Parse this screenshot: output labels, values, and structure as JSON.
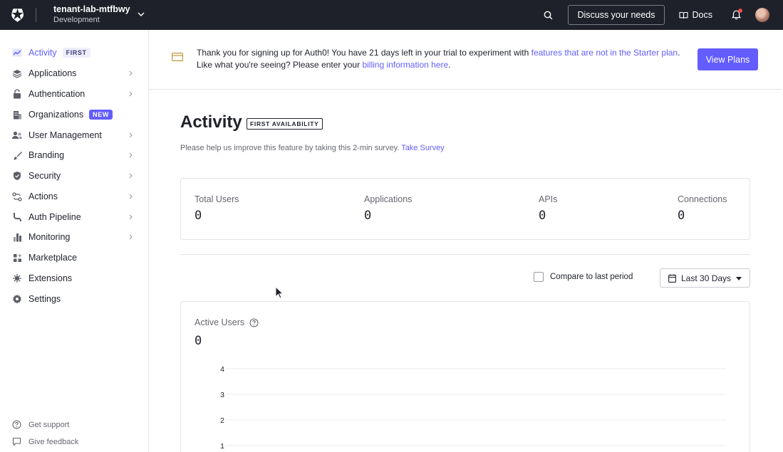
{
  "topbar": {
    "tenant_name": "tenant-lab-mtfbwy",
    "tenant_env": "Development",
    "discuss_label": "Discuss your needs",
    "docs_label": "Docs"
  },
  "sidebar": {
    "items": [
      {
        "label": "Activity",
        "badge": "FIRST",
        "active": true
      },
      {
        "label": "Applications"
      },
      {
        "label": "Authentication"
      },
      {
        "label": "Organizations",
        "badge": "NEW"
      },
      {
        "label": "User Management"
      },
      {
        "label": "Branding"
      },
      {
        "label": "Security"
      },
      {
        "label": "Actions"
      },
      {
        "label": "Auth Pipeline"
      },
      {
        "label": "Monitoring"
      },
      {
        "label": "Marketplace"
      },
      {
        "label": "Extensions"
      },
      {
        "label": "Settings"
      }
    ],
    "footer": {
      "support": "Get support",
      "feedback": "Give feedback"
    }
  },
  "banner": {
    "text1": "Thank you for signing up for Auth0! You have 21 days left in your trial to experiment with ",
    "link1": "features that are not in the Starter plan",
    "text2": ". Like what you're seeing? Please enter your ",
    "link2": "billing information here",
    "text3": ".",
    "button": "View Plans"
  },
  "page": {
    "title": "Activity",
    "title_badge": "FIRST AVAILABILITY",
    "survey_text": "Please help us improve this feature by taking this 2-min survey. ",
    "survey_link": "Take Survey"
  },
  "stats": [
    {
      "label": "Total Users",
      "value": "0"
    },
    {
      "label": "Applications",
      "value": "0"
    },
    {
      "label": "APIs",
      "value": "0"
    },
    {
      "label": "Connections",
      "value": "0"
    }
  ],
  "filters": {
    "compare_label": "Compare to last period",
    "compare_checked": false,
    "range_label": "Last 30 Days"
  },
  "active_users": {
    "title": "Active Users",
    "value": "0"
  },
  "chart_data": {
    "type": "line",
    "title": "Active Users",
    "y_ticks": [
      4,
      3,
      2,
      1
    ],
    "series": [],
    "grid": true
  }
}
